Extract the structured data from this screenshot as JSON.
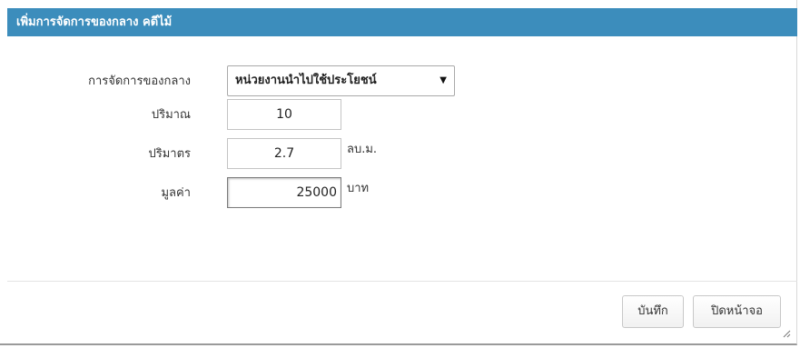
{
  "dialog": {
    "title": "เพิ่มการจัดการของกลาง คดีไม้"
  },
  "form": {
    "management": {
      "label": "การจัดการของกลาง",
      "selected": "หน่วยงานนำไปใช้ประโยชน์"
    },
    "quantity": {
      "label": "ปริมาณ",
      "value": "10"
    },
    "volume": {
      "label": "ปริมาตร",
      "value": "2.7",
      "unit": "ลบ.ม."
    },
    "value": {
      "label": "มูลค่า",
      "value": "25000",
      "unit": "บาท"
    }
  },
  "footer": {
    "save_label": "บันทึก",
    "close_label": "ปิดหน้าจอ"
  },
  "colors": {
    "header": "#3c8dbc"
  }
}
